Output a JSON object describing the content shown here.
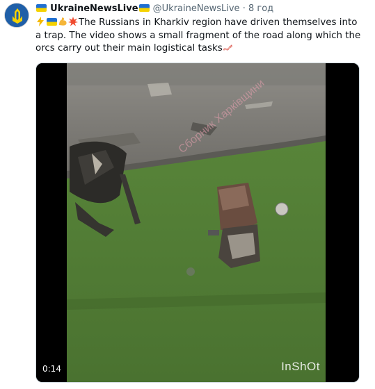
{
  "account": {
    "name": "UkraineNewsLive",
    "handle": "@UkraineNewsLive",
    "separator": "·",
    "time": "8 год"
  },
  "tweet": {
    "emojis": [
      "lightning-icon",
      "ukraine-flag-icon",
      "flexed-biceps-icon",
      "collision-icon"
    ],
    "text": "The Russians in Kharkiv region have driven themselves into a trap. The video shows a small fragment of the road along which the orcs carry out their main logistical tasks",
    "trailing_emoji": "bacon-icon"
  },
  "video": {
    "duration": "0:14",
    "app_watermark": "InShOt",
    "overlay_watermark": "Сборник Харківщини"
  },
  "colors": {
    "flag_blue": "#1f6fd1",
    "flag_yellow": "#f5d200",
    "grass": "#4f7a34",
    "road": "#8d8b86"
  }
}
